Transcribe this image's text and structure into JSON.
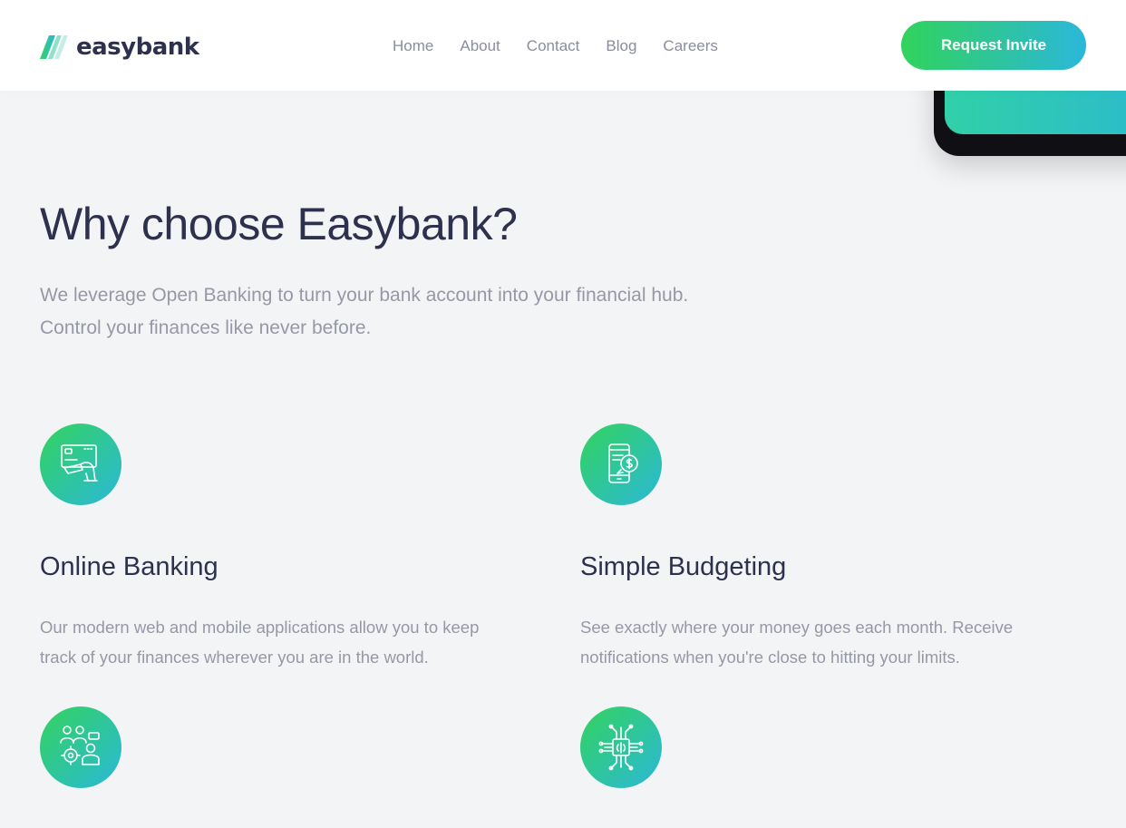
{
  "header": {
    "brand": "easybank",
    "nav": [
      "Home",
      "About",
      "Contact",
      "Blog",
      "Careers"
    ],
    "cta_label": "Request Invite"
  },
  "why": {
    "title": "Why choose Easybank?",
    "intro_line1": "We leverage Open Banking to turn your bank account into your financial hub.",
    "intro_line2": "Control your finances like never before."
  },
  "features": [
    {
      "icon": "online-banking-icon",
      "title": "Online Banking",
      "desc_line1": "Our modern web and mobile applications allow you to keep",
      "desc_line2": "track of your finances wherever you are in the world."
    },
    {
      "icon": "budgeting-icon",
      "title": "Simple Budgeting",
      "desc_line1": "See exactly where your money goes each month. Receive",
      "desc_line2": "notifications when you're close to hitting your limits."
    },
    {
      "icon": "onboarding-icon"
    },
    {
      "icon": "api-icon"
    }
  ],
  "colors": {
    "dark_blue": "#2d314d",
    "grayish_blue": "#9698a6",
    "lime_green": "#31d35c",
    "bright_cyan": "#2bb7da",
    "background": "#f3f4f6"
  }
}
